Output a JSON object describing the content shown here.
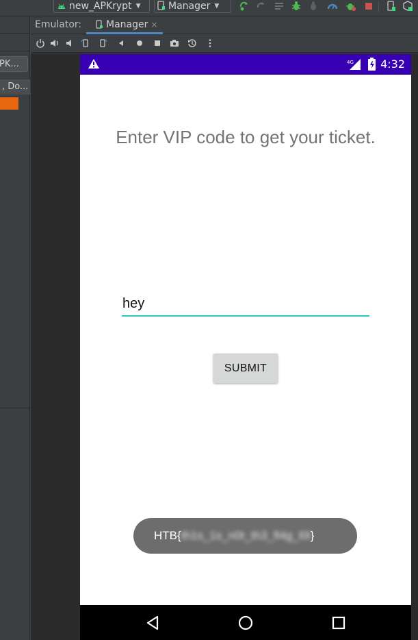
{
  "toolbar": {
    "run_config": "new_APKrypt",
    "device": "Manager",
    "icons": [
      "sync-icon",
      "sync-disabled-icon",
      "logcat-icon",
      "debug-icon",
      "attach-debugger-icon",
      "profile-icon",
      "apply-changes-icon",
      "stop-icon",
      "device-manager-icon",
      "sdk-manager-icon"
    ],
    "colors": {
      "android_green": "#3ddc84",
      "stop_red": "#c75450",
      "accent_blue": "#4a88c7"
    }
  },
  "left_panel": {
    "apk_button": "PK...",
    "tab_label": ", Do..."
  },
  "emulator": {
    "label": "Emulator:",
    "tab": "Manager",
    "tab_close": "×",
    "controls": [
      "power-icon",
      "volume-up-icon",
      "volume-down-icon",
      "rotate-left-icon",
      "rotate-right-icon",
      "back-icon",
      "home-icon",
      "overview-icon",
      "screenshot-icon",
      "snapshot-icon",
      "more-icon"
    ]
  },
  "phone": {
    "status_bar": {
      "time": "4:32",
      "network": "4G",
      "color": "#3700b3"
    },
    "title": "Enter VIP code to get your ticket.",
    "input_value": "hey",
    "submit_label": "SUBMIT",
    "toast": {
      "prefix": "HTB{",
      "redacted": "th1s_1s_n0t_th3_fl4g_l0l",
      "suffix": "}"
    },
    "accent_color": "#26c6c6"
  }
}
